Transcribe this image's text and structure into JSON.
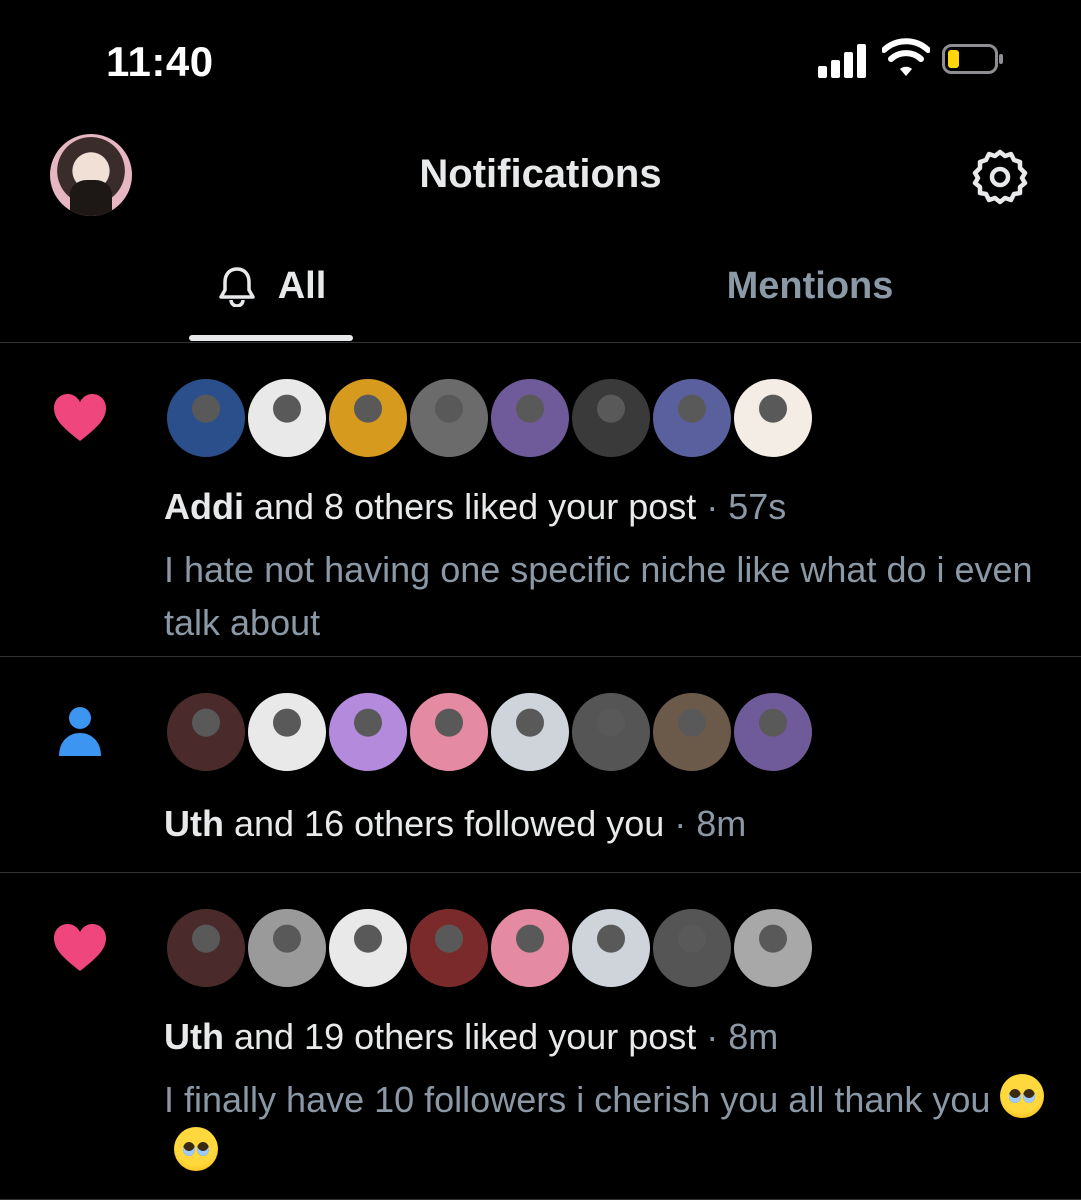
{
  "status_bar": {
    "time": "11:40"
  },
  "header": {
    "title": "Notifications"
  },
  "tabs": [
    {
      "label": "All",
      "active": true
    },
    {
      "label": "Mentions",
      "active": false
    }
  ],
  "notifications": [
    {
      "type": "like",
      "icon": "heart-icon",
      "user": "Addi",
      "action": " and 8 others liked your post",
      "time": "57s",
      "preview": "I hate not having one specific niche like what do i even talk about",
      "avatar_colors": [
        "#2b4f8a",
        "#e9e9e9",
        "#d69a1f",
        "#6b6b6b",
        "#6f5a9a",
        "#3a3a3a",
        "#5a5f9e",
        "#f4ede6"
      ]
    },
    {
      "type": "follow",
      "icon": "person-icon",
      "user": "Uth",
      "action": " and 16 others followed you",
      "time": "8m",
      "avatar_colors": [
        "#4a2a2a",
        "#e9e9e9",
        "#b48adc",
        "#e58aa3",
        "#cfd3da",
        "#555555",
        "#6b5a4a",
        "#6f5a9a"
      ]
    },
    {
      "type": "like",
      "icon": "heart-icon",
      "user": "Uth",
      "action": " and 19 others liked your post",
      "time": "8m",
      "preview": "I finally have 10 followers i cherish you all thank you",
      "preview_emojis": [
        "pleading-face-emoji",
        "pleading-face-emoji"
      ],
      "avatar_colors": [
        "#4a2a2a",
        "#9a9a9a",
        "#e9e9e9",
        "#7a2a2a",
        "#e58aa3",
        "#cfd3da",
        "#555555",
        "#a8a8a8"
      ]
    }
  ],
  "colors": {
    "heart": "#f0467e",
    "person": "#3d95f2",
    "muted": "#8b98a5",
    "text": "#e7e9ea"
  }
}
